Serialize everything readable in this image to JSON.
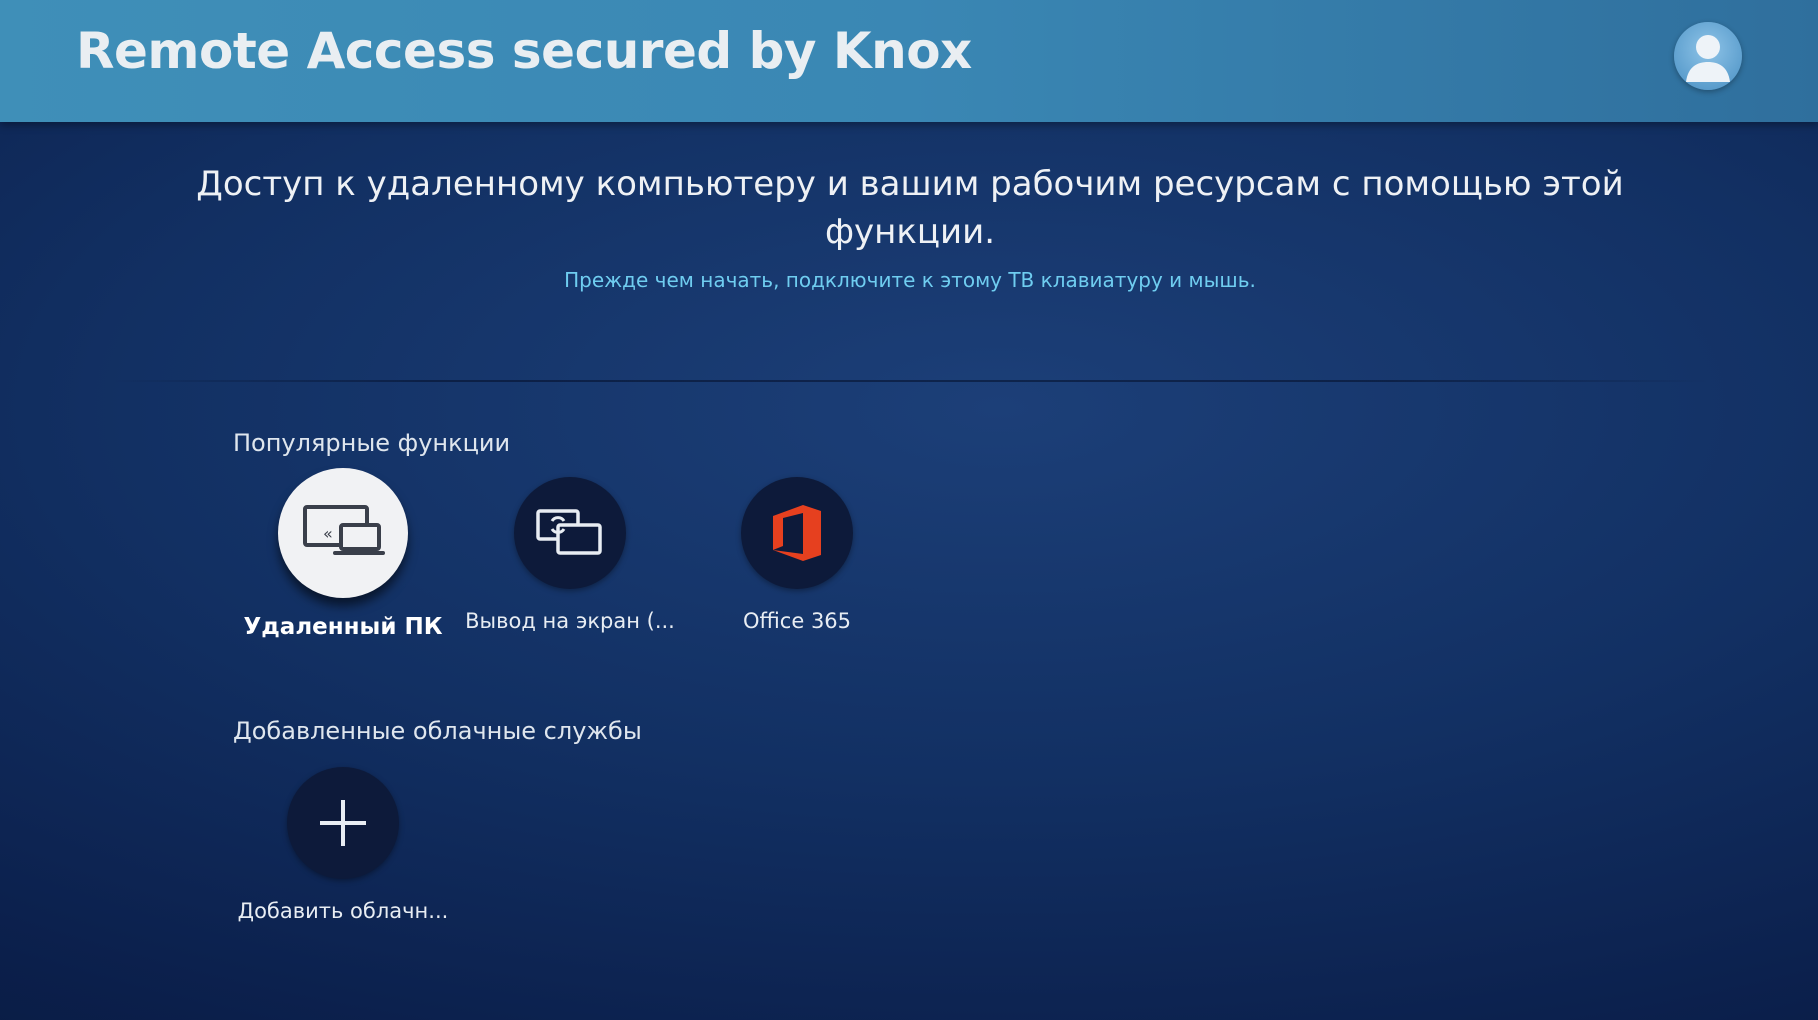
{
  "header": {
    "title": "Remote Access secured by Knox",
    "profile_icon": "user-profile-icon"
  },
  "intro": {
    "main_text": "Доступ к удаленному компьютеру и вашим рабочим ресурсам с помощью этой функции.",
    "hint_text": "Прежде чем начать, подключите к этому ТВ клавиатуру и мышь."
  },
  "popular": {
    "title": "Популярные функции",
    "items": [
      {
        "label": "Удаленный ПК",
        "icon": "remote-pc-icon",
        "focused": true
      },
      {
        "label": "Вывод на экран (...",
        "icon": "screen-mirroring-icon",
        "focused": false
      },
      {
        "label": "Office 365",
        "icon": "office-365-icon",
        "focused": false
      }
    ]
  },
  "cloud": {
    "title": "Добавленные облачные службы",
    "items": [
      {
        "label": "Добавить облачн...",
        "icon": "plus-icon"
      }
    ]
  },
  "colors": {
    "header_bg": "#3a87b4",
    "background": "#123063",
    "hint_text": "#6fcdf0",
    "office_red": "#e6401f",
    "focus_circle": "#f1f2f4"
  }
}
